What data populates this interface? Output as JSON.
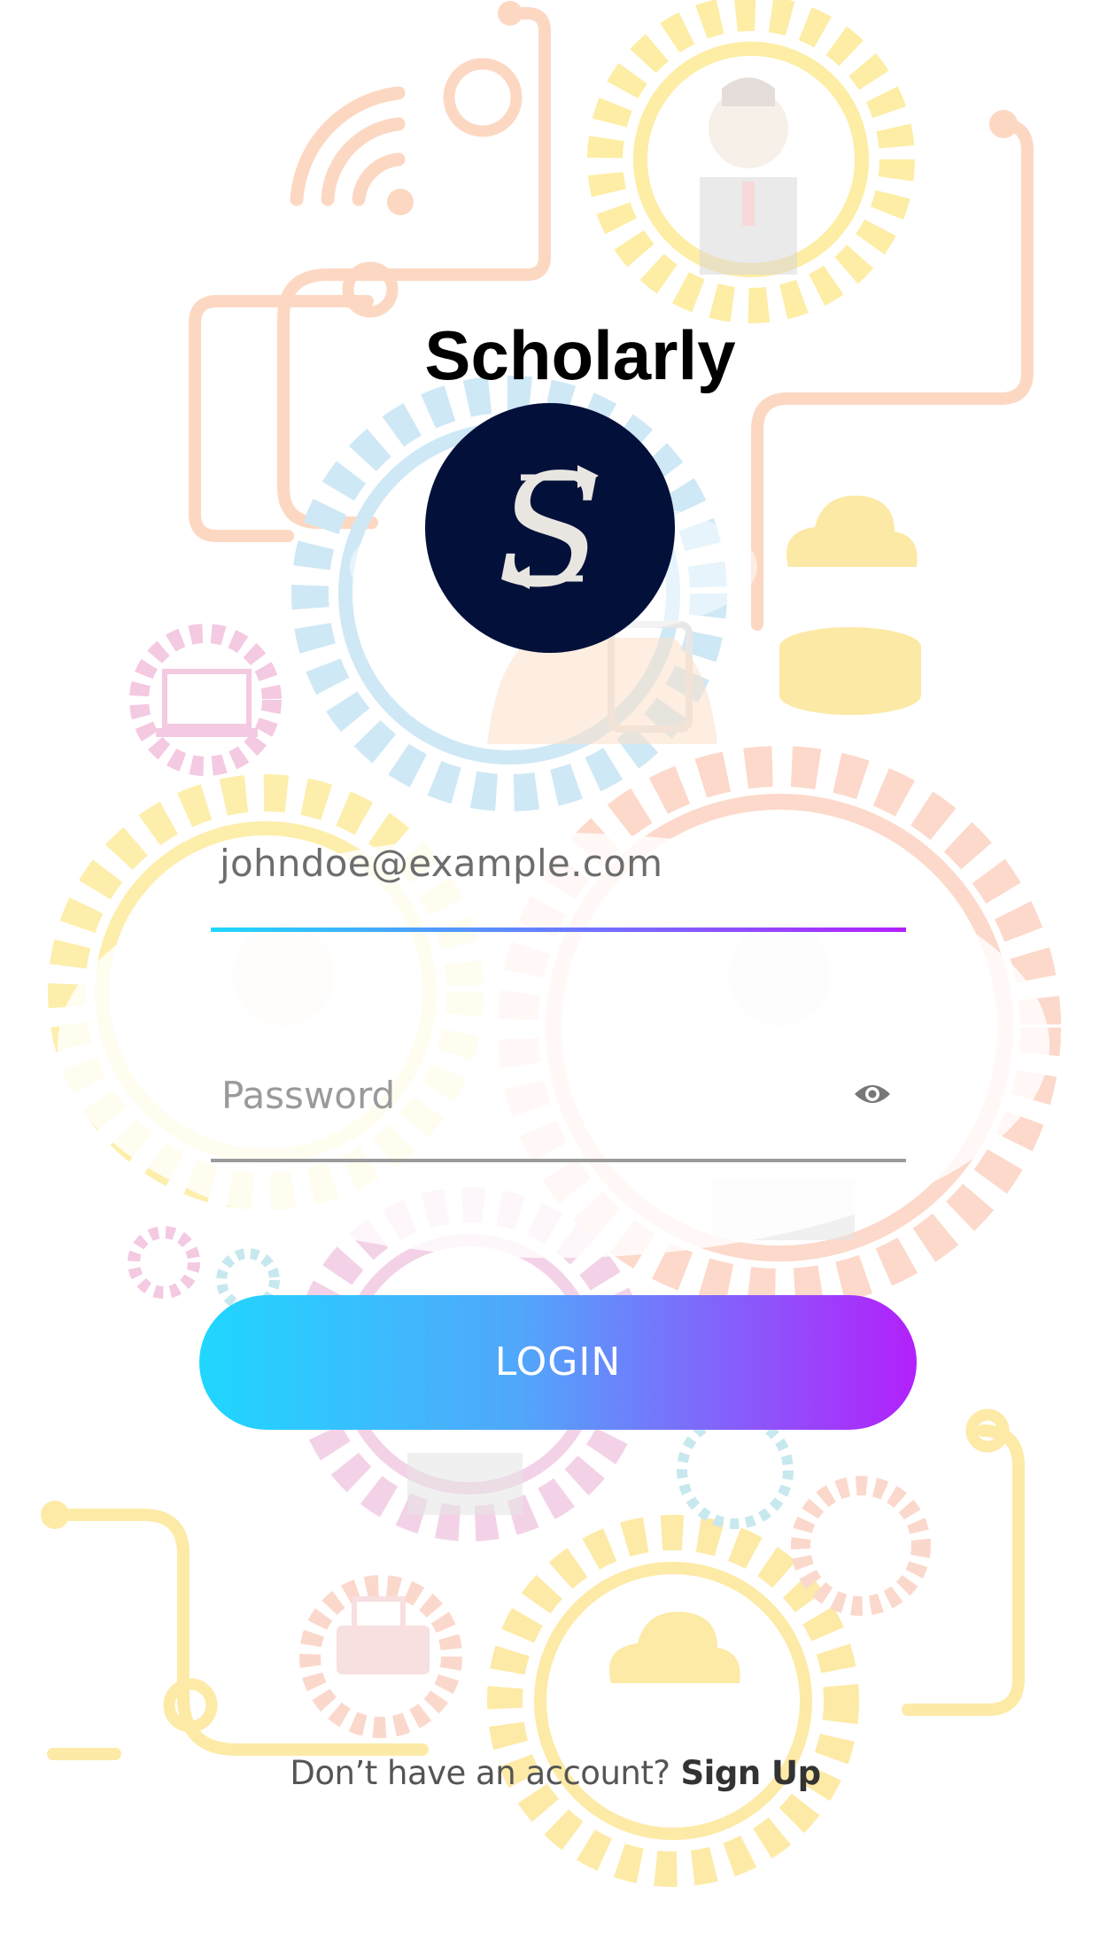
{
  "app": {
    "title": "Scholarly",
    "logo_letter": "S"
  },
  "login_form": {
    "email_value": "johndoe@example.com",
    "password_placeholder": "Password",
    "login_label": "LOGIN"
  },
  "footer": {
    "prompt": "Don’t have an account?",
    "signup_label": "Sign Up"
  },
  "colors": {
    "logo_background": "#03113a",
    "gradient_start": "#1fd7ff",
    "gradient_end": "#b320fb",
    "illustration_yellow": "#fdeea6",
    "illustration_orange": "#fbd8c2",
    "illustration_blue": "#c9e7f7",
    "illustration_pink": "#f1cfe6"
  },
  "icons": {
    "password_toggle": "eye-icon"
  }
}
